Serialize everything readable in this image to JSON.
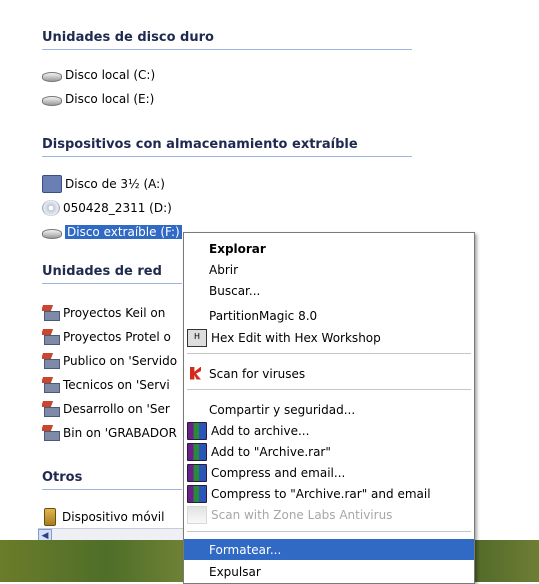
{
  "groups": {
    "hard_drives": {
      "title": "Unidades de disco duro",
      "items": [
        "Disco local (C:)",
        "Disco local (E:)"
      ]
    },
    "removable": {
      "title": "Dispositivos con almacenamiento extraíble",
      "items": [
        "Disco de 3½ (A:)",
        "050428_2311 (D:)",
        "Disco extraíble (F:)"
      ]
    },
    "network": {
      "title": "Unidades de red",
      "items": [
        "Proyectos Keil on",
        "Proyectos Protel o",
        "Publico on 'Servido",
        "Tecnicos on 'Servi",
        "Desarrollo on 'Ser",
        "Bin on 'GRABADOR"
      ]
    },
    "other": {
      "title": "Otros",
      "items": [
        "Dispositivo móvil"
      ]
    }
  },
  "context_menu": {
    "items": [
      "Explorar",
      "Abrir",
      "Buscar...",
      "PartitionMagic 8.0",
      "Hex Edit with Hex Workshop",
      "Scan for viruses",
      "Compartir y seguridad...",
      "Add to archive...",
      "Add to \"Archive.rar\"",
      "Compress and email...",
      "Compress to \"Archive.rar\" and email",
      "Scan with Zone Labs Antivirus",
      "Formatear...",
      "Expulsar"
    ],
    "highlighted": "Formatear..."
  },
  "colors": {
    "selection": "#316ac5",
    "group_header_text": "#1f2a4f",
    "group_header_rule": "#9db6e1"
  }
}
